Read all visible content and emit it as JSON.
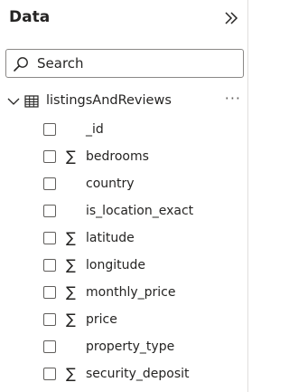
{
  "pane": {
    "title": "Data",
    "collapse_icon": "double-chevron-right-icon"
  },
  "search": {
    "placeholder": "Search",
    "value": ""
  },
  "table": {
    "name": "listingsAndReviews",
    "more_label": "···",
    "expanded": true
  },
  "fields": [
    {
      "name": "_id",
      "aggregated": false
    },
    {
      "name": "bedrooms",
      "aggregated": true,
      "sigma": "∑"
    },
    {
      "name": "country",
      "aggregated": false
    },
    {
      "name": "is_location_exact",
      "aggregated": false
    },
    {
      "name": "latitude",
      "aggregated": true,
      "sigma": "∑"
    },
    {
      "name": "longitude",
      "aggregated": true,
      "sigma": "∑"
    },
    {
      "name": "monthly_price",
      "aggregated": true,
      "sigma": "∑"
    },
    {
      "name": "price",
      "aggregated": true,
      "sigma": "∑"
    },
    {
      "name": "property_type",
      "aggregated": false
    },
    {
      "name": "security_deposit",
      "aggregated": true,
      "sigma": "∑"
    }
  ]
}
